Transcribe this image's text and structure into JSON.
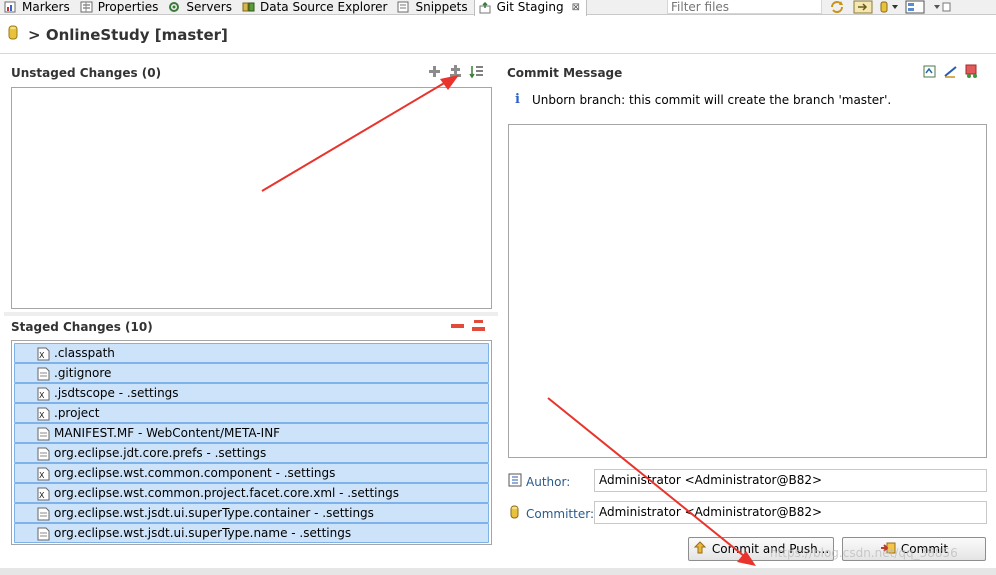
{
  "tabs": [
    {
      "label": "Markers",
      "icon": "markers-icon"
    },
    {
      "label": "Properties",
      "icon": "properties-icon"
    },
    {
      "label": "Servers",
      "icon": "servers-icon"
    },
    {
      "label": "Data Source Explorer",
      "icon": "data-source-icon"
    },
    {
      "label": "Snippets",
      "icon": "snippets-icon"
    },
    {
      "label": "Git Staging",
      "icon": "git-staging-icon",
      "close": "⊠"
    }
  ],
  "filter": {
    "placeholder": "Filter files"
  },
  "header": {
    "prefix": ">",
    "title": "OnlineStudy [master]"
  },
  "unstaged": {
    "title": "Unstaged Changes (0)"
  },
  "staged": {
    "title": "Staged Changes (10)",
    "files": [
      {
        "name": ".classpath",
        "icon": "xml-file-icon"
      },
      {
        "name": ".gitignore",
        "icon": "text-file-icon"
      },
      {
        "name": ".jsdtscope - .settings",
        "icon": "xml-file-icon"
      },
      {
        "name": ".project",
        "icon": "xml-file-icon"
      },
      {
        "name": "MANIFEST.MF - WebContent/META-INF",
        "icon": "text-file-icon"
      },
      {
        "name": "org.eclipse.jdt.core.prefs - .settings",
        "icon": "text-file-icon"
      },
      {
        "name": "org.eclipse.wst.common.component - .settings",
        "icon": "xml-file-icon"
      },
      {
        "name": "org.eclipse.wst.common.project.facet.core.xml - .settings",
        "icon": "xml-file-icon"
      },
      {
        "name": "org.eclipse.wst.jsdt.ui.superType.container - .settings",
        "icon": "text-file-icon"
      },
      {
        "name": "org.eclipse.wst.jsdt.ui.superType.name - .settings",
        "icon": "text-file-icon"
      }
    ]
  },
  "commit": {
    "title": "Commit Message",
    "info_icon": "i",
    "info": "Unborn branch: this commit will create the branch 'master'.",
    "author_label": "Author:",
    "author_value": "Administrator <Administrator@B82>",
    "committer_label": "Committer:",
    "committer_value": "Administrator <Administrator@B82>",
    "commit_push_label": "Commit and Push...",
    "commit_label": "Commit"
  },
  "watermark": "https://blog.csdn.net/qq_38856"
}
